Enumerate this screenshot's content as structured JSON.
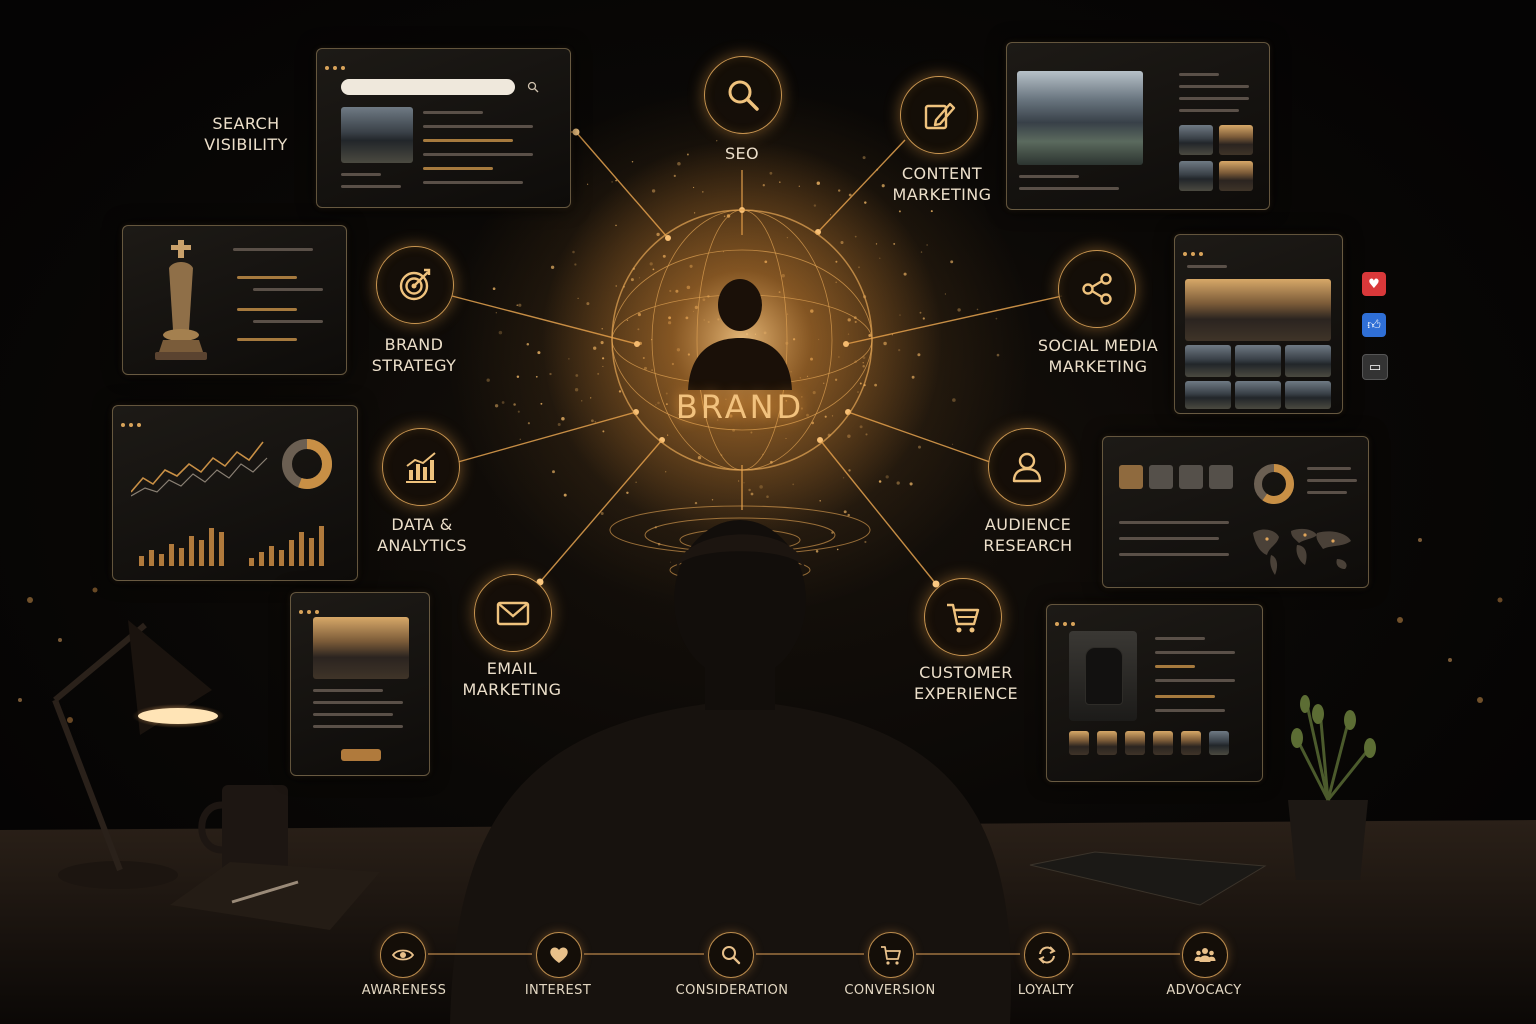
{
  "center": {
    "label": "BRAND"
  },
  "channels": [
    {
      "id": "seo",
      "icon": "search-icon",
      "lines": [
        "SEO"
      ]
    },
    {
      "id": "content-marketing",
      "icon": "edit-icon",
      "lines": [
        "CONTENT",
        "MARKETING"
      ]
    },
    {
      "id": "brand-strategy",
      "icon": "target-icon",
      "lines": [
        "BRAND",
        "STRATEGY"
      ]
    },
    {
      "id": "social-media-marketing",
      "icon": "share-icon",
      "lines": [
        "SOCIAL MEDIA",
        "MARKETING"
      ]
    },
    {
      "id": "data-analytics",
      "icon": "bar-chart-icon",
      "lines": [
        "DATA &",
        "ANALYTICS"
      ]
    },
    {
      "id": "audience-research",
      "icon": "user-icon",
      "lines": [
        "AUDIENCE",
        "RESEARCH"
      ]
    },
    {
      "id": "email-marketing",
      "icon": "mail-icon",
      "lines": [
        "EMAIL",
        "MARKETING"
      ]
    },
    {
      "id": "customer-experience",
      "icon": "cart-icon",
      "lines": [
        "CUSTOMER",
        "EXPERIENCE"
      ]
    }
  ],
  "search_visibility": {
    "lines": [
      "SEARCH",
      "VISIBILITY"
    ]
  },
  "journey": [
    {
      "label": "AWARENESS",
      "icon": "eye-icon"
    },
    {
      "label": "INTEREST",
      "icon": "heart-icon"
    },
    {
      "label": "CONSIDERATION",
      "icon": "search-icon"
    },
    {
      "label": "CONVERSION",
      "icon": "cart-icon"
    },
    {
      "label": "LOYALTY",
      "icon": "refresh-icon"
    },
    {
      "label": "ADVOCACY",
      "icon": "people-icon"
    }
  ],
  "reactions": [
    {
      "icon": "heart-icon",
      "color": "#d9383a"
    },
    {
      "icon": "thumbs-up-icon",
      "color": "#2f6fd6"
    },
    {
      "icon": "comment-icon",
      "color": "#3a3a3a"
    }
  ],
  "colors": {
    "accent": "#e0a55a",
    "text": "#ecdfca",
    "background": "#070605"
  }
}
